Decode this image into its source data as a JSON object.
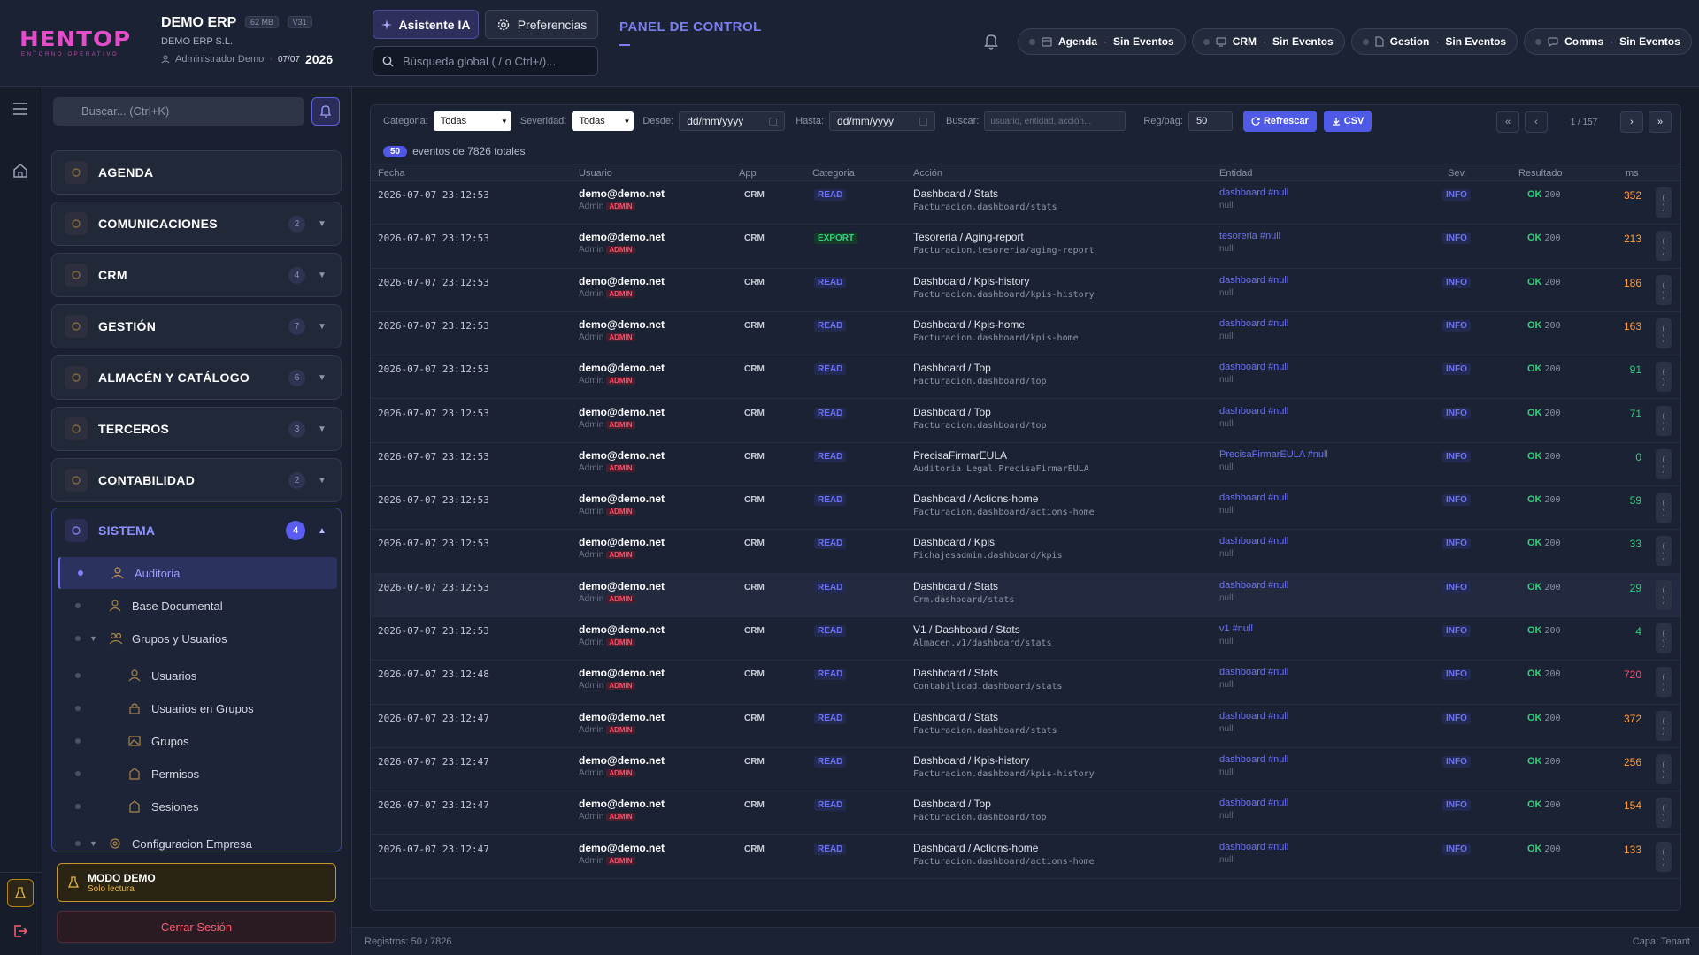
{
  "header": {
    "logo_text": "HENTOP",
    "logo_sub": "ENTORNO OPERATIVO",
    "company_name": "DEMO ERP",
    "badge_mb": "62 MB",
    "badge_version": "V31",
    "company_sub": "DEMO ERP S.L.",
    "user": "Administrador Demo",
    "date": "07/07",
    "year": "2026",
    "ai_button": "Asistente IA",
    "prefs_button": "Preferencias",
    "search_placeholder": "Búsqueda global ( / o Ctrl+/)...",
    "panel_title": "PANEL DE CONTROL",
    "status_chips": [
      {
        "name": "Agenda",
        "status": "Sin Eventos",
        "icon": "calendar-icon"
      },
      {
        "name": "CRM",
        "status": "Sin Eventos",
        "icon": "monitor-icon"
      },
      {
        "name": "Gestion",
        "status": "Sin Eventos",
        "icon": "document-icon"
      },
      {
        "name": "Comms",
        "status": "Sin Eventos",
        "icon": "chat-icon"
      }
    ]
  },
  "sidebar": {
    "search_placeholder": "Buscar... (Ctrl+K)",
    "modules": [
      {
        "label": "AGENDA",
        "count": ""
      },
      {
        "label": "COMUNICACIONES",
        "count": "2"
      },
      {
        "label": "CRM",
        "count": "4"
      },
      {
        "label": "GESTIÓN",
        "count": "7"
      },
      {
        "label": "ALMACÉN Y CATÁLOGO",
        "count": "6"
      },
      {
        "label": "TERCEROS",
        "count": "3"
      },
      {
        "label": "CONTABILIDAD",
        "count": "2"
      }
    ],
    "sistema": {
      "label": "SISTEMA",
      "count": "4",
      "items": [
        {
          "label": "Auditoria",
          "level": 1,
          "active": true
        },
        {
          "label": "Base Documental",
          "level": 1
        },
        {
          "label": "Grupos y Usuarios",
          "level": 1,
          "expandable": true
        },
        {
          "label": "Usuarios",
          "level": 2
        },
        {
          "label": "Usuarios en Grupos",
          "level": 2
        },
        {
          "label": "Grupos",
          "level": 2
        },
        {
          "label": "Permisos",
          "level": 2
        },
        {
          "label": "Sesiones",
          "level": 2
        },
        {
          "label": "Configuracion Empresa",
          "level": 1,
          "expandable": true
        }
      ]
    },
    "demo_title": "MODO DEMO",
    "demo_sub": "Solo lectura",
    "logout": "Cerrar Sesión"
  },
  "filters": {
    "categoria_label": "Categoria:",
    "categoria_value": "Todas",
    "severidad_label": "Severidad:",
    "severidad_value": "Todas",
    "desde_label": "Desde:",
    "desde_value": "dd/mm/yyyy",
    "hasta_label": "Hasta:",
    "hasta_value": "dd/mm/yyyy",
    "buscar_label": "Buscar:",
    "buscar_placeholder": "usuario, entidad, acción...",
    "regpag_label": "Reg/pág:",
    "regpag_value": "50",
    "refresh": "Refrescar",
    "csv": "CSV",
    "page_text": "1 / 157"
  },
  "summary": {
    "count": "50",
    "text": "eventos de 7826 totales"
  },
  "table": {
    "headers": [
      "Fecha",
      "Usuario",
      "App",
      "Categoria",
      "Acción",
      "Entidad",
      "Sev.",
      "Resultado",
      "ms"
    ],
    "rows": [
      {
        "date": "2026-07-07 23:12:53",
        "user": "demo@demo.net",
        "role": "Admin",
        "tag": "ADMIN",
        "app": "CRM",
        "cat": "READ",
        "action": "Dashboard / Stats",
        "path": "Facturacion.dashboard/stats",
        "entity": "dashboard #null",
        "entity_sub": "null",
        "sev": "INFO",
        "res": "OK",
        "code": "200",
        "ms": "352",
        "ms_color": "orange"
      },
      {
        "date": "2026-07-07 23:12:53",
        "user": "demo@demo.net",
        "role": "Admin",
        "tag": "ADMIN",
        "app": "CRM",
        "cat": "EXPORT",
        "action": "Tesoreria / Aging-report",
        "path": "Facturacion.tesoreria/aging-report",
        "entity": "tesoreria #null",
        "entity_sub": "null",
        "sev": "INFO",
        "res": "OK",
        "code": "200",
        "ms": "213",
        "ms_color": "orange"
      },
      {
        "date": "2026-07-07 23:12:53",
        "user": "demo@demo.net",
        "role": "Admin",
        "tag": "ADMIN",
        "app": "CRM",
        "cat": "READ",
        "action": "Dashboard / Kpis-history",
        "path": "Facturacion.dashboard/kpis-history",
        "entity": "dashboard #null",
        "entity_sub": "null",
        "sev": "INFO",
        "res": "OK",
        "code": "200",
        "ms": "186",
        "ms_color": "orange"
      },
      {
        "date": "2026-07-07 23:12:53",
        "user": "demo@demo.net",
        "role": "Admin",
        "tag": "ADMIN",
        "app": "CRM",
        "cat": "READ",
        "action": "Dashboard / Kpis-home",
        "path": "Facturacion.dashboard/kpis-home",
        "entity": "dashboard #null",
        "entity_sub": "null",
        "sev": "INFO",
        "res": "OK",
        "code": "200",
        "ms": "163",
        "ms_color": "orange"
      },
      {
        "date": "2026-07-07 23:12:53",
        "user": "demo@demo.net",
        "role": "Admin",
        "tag": "ADMIN",
        "app": "CRM",
        "cat": "READ",
        "action": "Dashboard / Top",
        "path": "Facturacion.dashboard/top",
        "entity": "dashboard #null",
        "entity_sub": "null",
        "sev": "INFO",
        "res": "OK",
        "code": "200",
        "ms": "91",
        "ms_color": "green"
      },
      {
        "date": "2026-07-07 23:12:53",
        "user": "demo@demo.net",
        "role": "Admin",
        "tag": "ADMIN",
        "app": "CRM",
        "cat": "READ",
        "action": "Dashboard / Top",
        "path": "Facturacion.dashboard/top",
        "entity": "dashboard #null",
        "entity_sub": "null",
        "sev": "INFO",
        "res": "OK",
        "code": "200",
        "ms": "71",
        "ms_color": "green"
      },
      {
        "date": "2026-07-07 23:12:53",
        "user": "demo@demo.net",
        "role": "Admin",
        "tag": "ADMIN",
        "app": "CRM",
        "cat": "READ",
        "action": "PrecisaFirmarEULA",
        "path": "Auditoria Legal.PrecisaFirmarEULA",
        "entity": "PrecisaFirmarEULA #null",
        "entity_sub": "null",
        "sev": "INFO",
        "res": "OK",
        "code": "200",
        "ms": "0",
        "ms_color": "green"
      },
      {
        "date": "2026-07-07 23:12:53",
        "user": "demo@demo.net",
        "role": "Admin",
        "tag": "ADMIN",
        "app": "CRM",
        "cat": "READ",
        "action": "Dashboard / Actions-home",
        "path": "Facturacion.dashboard/actions-home",
        "entity": "dashboard #null",
        "entity_sub": "null",
        "sev": "INFO",
        "res": "OK",
        "code": "200",
        "ms": "59",
        "ms_color": "green"
      },
      {
        "date": "2026-07-07 23:12:53",
        "user": "demo@demo.net",
        "role": "Admin",
        "tag": "ADMIN",
        "app": "CRM",
        "cat": "READ",
        "action": "Dashboard / Kpis",
        "path": "Fichajesadmin.dashboard/kpis",
        "entity": "dashboard #null",
        "entity_sub": "null",
        "sev": "INFO",
        "res": "OK",
        "code": "200",
        "ms": "33",
        "ms_color": "green"
      },
      {
        "date": "2026-07-07 23:12:53",
        "user": "demo@demo.net",
        "role": "Admin",
        "tag": "ADMIN",
        "app": "CRM",
        "cat": "READ",
        "action": "Dashboard / Stats",
        "path": "Crm.dashboard/stats",
        "entity": "dashboard #null",
        "entity_sub": "null",
        "sev": "INFO",
        "res": "OK",
        "code": "200",
        "ms": "29",
        "ms_color": "green",
        "highlight": true
      },
      {
        "date": "2026-07-07 23:12:53",
        "user": "demo@demo.net",
        "role": "Admin",
        "tag": "ADMIN",
        "app": "CRM",
        "cat": "READ",
        "action": "V1 / Dashboard / Stats",
        "path": "Almacen.v1/dashboard/stats",
        "entity": "v1 #null",
        "entity_sub": "null",
        "sev": "INFO",
        "res": "OK",
        "code": "200",
        "ms": "4",
        "ms_color": "green"
      },
      {
        "date": "2026-07-07 23:12:48",
        "user": "demo@demo.net",
        "role": "Admin",
        "tag": "ADMIN",
        "app": "CRM",
        "cat": "READ",
        "action": "Dashboard / Stats",
        "path": "Contabilidad.dashboard/stats",
        "entity": "dashboard #null",
        "entity_sub": "null",
        "sev": "INFO",
        "res": "OK",
        "code": "200",
        "ms": "720",
        "ms_color": "red"
      },
      {
        "date": "2026-07-07 23:12:47",
        "user": "demo@demo.net",
        "role": "Admin",
        "tag": "ADMIN",
        "app": "CRM",
        "cat": "READ",
        "action": "Dashboard / Stats",
        "path": "Facturacion.dashboard/stats",
        "entity": "dashboard #null",
        "entity_sub": "null",
        "sev": "INFO",
        "res": "OK",
        "code": "200",
        "ms": "372",
        "ms_color": "orange"
      },
      {
        "date": "2026-07-07 23:12:47",
        "user": "demo@demo.net",
        "role": "Admin",
        "tag": "ADMIN",
        "app": "CRM",
        "cat": "READ",
        "action": "Dashboard / Kpis-history",
        "path": "Facturacion.dashboard/kpis-history",
        "entity": "dashboard #null",
        "entity_sub": "null",
        "sev": "INFO",
        "res": "OK",
        "code": "200",
        "ms": "256",
        "ms_color": "orange"
      },
      {
        "date": "2026-07-07 23:12:47",
        "user": "demo@demo.net",
        "role": "Admin",
        "tag": "ADMIN",
        "app": "CRM",
        "cat": "READ",
        "action": "Dashboard / Top",
        "path": "Facturacion.dashboard/top",
        "entity": "dashboard #null",
        "entity_sub": "null",
        "sev": "INFO",
        "res": "OK",
        "code": "200",
        "ms": "154",
        "ms_color": "orange"
      },
      {
        "date": "2026-07-07 23:12:47",
        "user": "demo@demo.net",
        "role": "Admin",
        "tag": "ADMIN",
        "app": "CRM",
        "cat": "READ",
        "action": "Dashboard / Actions-home",
        "path": "Facturacion.dashboard/actions-home",
        "entity": "dashboard #null",
        "entity_sub": "null",
        "sev": "INFO",
        "res": "OK",
        "code": "200",
        "ms": "133",
        "ms_color": "orange"
      }
    ]
  },
  "footer": {
    "left": "Registros: 50 / 7826",
    "right": "Capa: Tenant"
  }
}
